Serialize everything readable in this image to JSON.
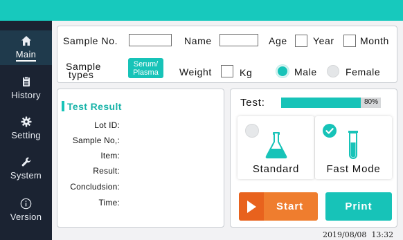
{
  "sidebar": {
    "items": [
      {
        "label": "Main",
        "icon": "home-icon",
        "active": true
      },
      {
        "label": "History",
        "icon": "clipboard-icon",
        "active": false
      },
      {
        "label": "Setting",
        "icon": "gear-icon",
        "active": false
      },
      {
        "label": "System",
        "icon": "wrench-icon",
        "active": false
      },
      {
        "label": "Version",
        "icon": "info-icon",
        "active": false
      }
    ]
  },
  "sample_info": {
    "sample_no_label": "Sample No.",
    "sample_no_value": "",
    "name_label": "Name",
    "name_value": "",
    "age_label": "Age",
    "year_label": "Year",
    "month_label": "Month",
    "sample_types_label_1": "Sample",
    "sample_types_label_2": "types",
    "sample_type_value_1": "Serum/",
    "sample_type_value_2": "Plasma",
    "weight_label": "Weight",
    "weight_unit": "Kg",
    "male_label": "Male",
    "female_label": "Female",
    "gender_selected": "Male"
  },
  "test_result": {
    "title": "Test Result",
    "lot_id_label": "Lot ID:",
    "sample_no_label": "Sample No,:",
    "item_label": "Item:",
    "result_label": "Result:",
    "conclusion_label": "Concludsion:",
    "time_label": "Time:"
  },
  "test": {
    "label": "Test:",
    "progress_percent": 80,
    "progress_text": "80%",
    "modes": [
      {
        "label": "Standard",
        "selected": false
      },
      {
        "label": "Fast Mode",
        "selected": true
      }
    ]
  },
  "actions": {
    "start_label": "Start",
    "print_label": "Print"
  },
  "status": {
    "datetime": "2019/08/08  13:32"
  },
  "colors": {
    "accent": "#17c3b8",
    "sidebar_bg": "#1b2332",
    "start_orange": "#ef7d2e"
  }
}
